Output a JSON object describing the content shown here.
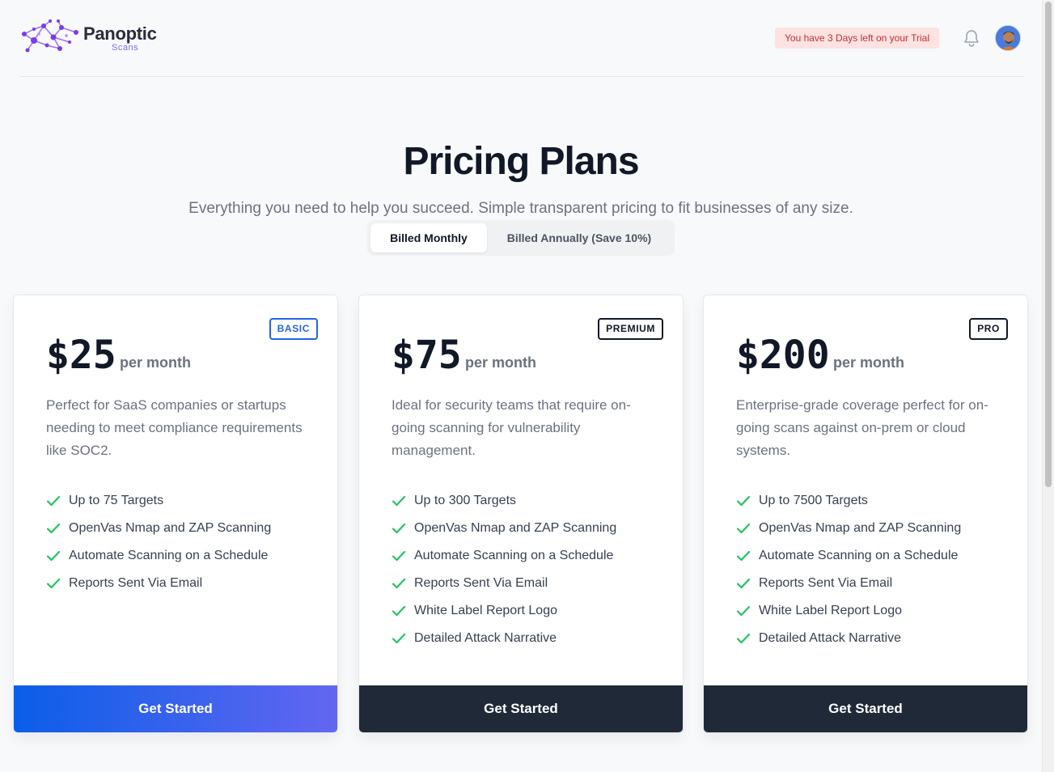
{
  "header": {
    "brand": "Panoptic",
    "brand_sub": "Scans",
    "trial_notice": "You have 3 Days left on your Trial"
  },
  "main": {
    "title": "Pricing Plans",
    "subtitle": "Everything you need to help you succeed. Simple transparent pricing to fit businesses of any size.",
    "billing_toggle": {
      "monthly": "Billed Monthly",
      "annually": "Billed Annually (Save 10%)",
      "selected": "monthly"
    }
  },
  "plans": [
    {
      "badge": "BASIC",
      "price": "$25",
      "period": "per month",
      "description": "Perfect for SaaS companies or startups needing to meet compliance requirements like SOC2.",
      "features": [
        "Up to 75 Targets",
        "OpenVas Nmap and ZAP Scanning",
        "Automate Scanning on a Schedule",
        "Reports Sent Via Email"
      ],
      "cta": "Get Started"
    },
    {
      "badge": "PREMIUM",
      "price": "$75",
      "period": "per month",
      "description": "Ideal for security teams that require on-going scanning for vulnerability management.",
      "features": [
        "Up to 300 Targets",
        "OpenVas Nmap and ZAP Scanning",
        "Automate Scanning on a Schedule",
        "Reports Sent Via Email",
        "White Label Report Logo",
        "Detailed Attack Narrative"
      ],
      "cta": "Get Started"
    },
    {
      "badge": "PRO",
      "price": "$200",
      "period": "per month",
      "description": "Enterprise-grade coverage perfect for on-going scans against on-prem or cloud systems.",
      "features": [
        "Up to 7500 Targets",
        "OpenVas Nmap and ZAP Scanning",
        "Automate Scanning on a Schedule",
        "Reports Sent Via Email",
        "White Label Report Logo",
        "Detailed Attack Narrative"
      ],
      "cta": "Get Started"
    }
  ],
  "icons": {
    "logo": "network-nodes-icon",
    "bell": "bell-icon",
    "check": "check-icon",
    "avatar": "user-avatar"
  },
  "colors": {
    "accent_blue": "#2563eb",
    "check_green": "#22c55e",
    "dark_button": "#1f2937",
    "trial_bg": "#fde2e2",
    "trial_text": "#c53030"
  }
}
